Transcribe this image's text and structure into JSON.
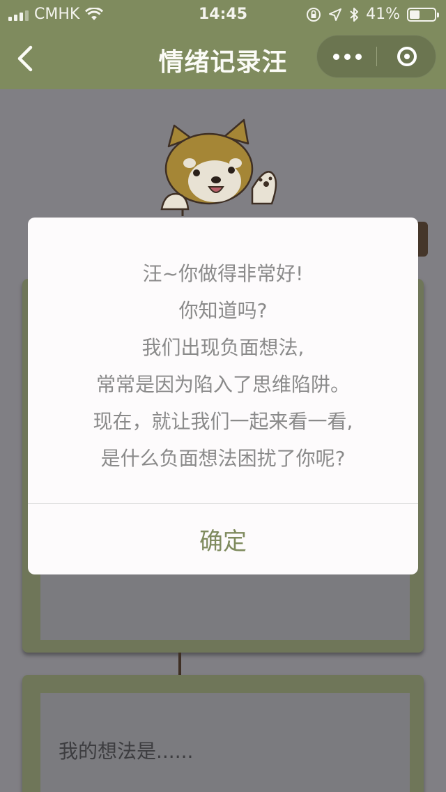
{
  "status_bar": {
    "carrier": "CMHK",
    "time": "14:45",
    "battery_percent_text": "41%",
    "battery_level": 0.41,
    "icons": [
      "signal-icon",
      "wifi-icon",
      "orientation-lock-icon",
      "location-icon",
      "bluetooth-icon",
      "battery-icon"
    ]
  },
  "navbar": {
    "title": "情绪记录汪",
    "icons": {
      "back": "chevron-left-icon",
      "more": "more-dots-icon",
      "close": "target-circle-icon"
    }
  },
  "colors": {
    "accent": "#7f8b5e",
    "overlay_bg": "#807f84",
    "card": "#6f7659",
    "modal_text": "#8a8a8a",
    "modal_bg": "#fdfbfc"
  },
  "background": {
    "mascot": "shiba-dog-mascot",
    "thought_placeholder": "我的想法是......"
  },
  "modal": {
    "lines": [
      "汪~你做得非常好!",
      "你知道吗?",
      "我们出现负面想法,",
      "常常是因为陷入了思维陷阱。",
      "现在，就让我们一起来看一看,",
      "是什么负面想法困扰了你呢?"
    ],
    "confirm_label": "确定"
  }
}
